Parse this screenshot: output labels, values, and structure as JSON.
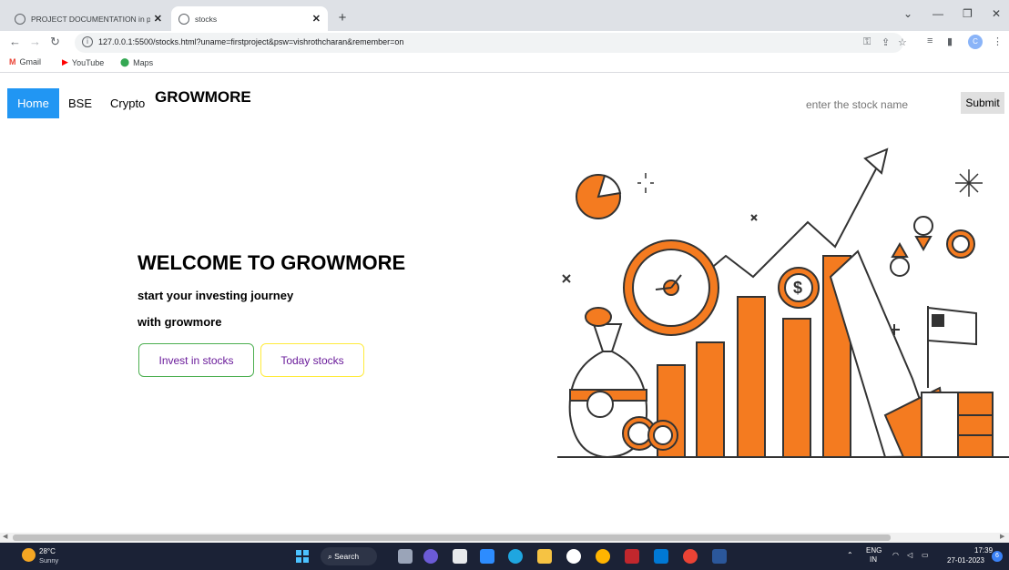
{
  "browser": {
    "tabs": [
      {
        "title": "PROJECT DOCUMENTATION in p",
        "active": false
      },
      {
        "title": "stocks",
        "active": true
      }
    ],
    "url": "127.0.0.1:5500/stocks.html?uname=firstproject&psw=vishrothcharan&remember=on",
    "bookmarks": [
      {
        "label": "Gmail",
        "icon": "gmail-icon",
        "color": "#ea4335"
      },
      {
        "label": "YouTube",
        "icon": "youtube-icon",
        "color": "#ff0000"
      },
      {
        "label": "Maps",
        "icon": "maps-icon",
        "color": "#34a853"
      }
    ],
    "profile_initial": "C"
  },
  "page": {
    "nav": {
      "home": "Home",
      "bse": "BSE",
      "crypto": "Crypto",
      "brand": "GROWMORE"
    },
    "search": {
      "placeholder": "enter the stock name",
      "submit": "Submit"
    },
    "hero": {
      "title": "WELCOME TO GROWMORE",
      "line1": "start your investing journey",
      "line2": "with growmore",
      "invest_button": "Invest in stocks",
      "today_button": "Today stocks"
    },
    "colors": {
      "accent": "#2196f3",
      "illustration_orange": "#f47b20",
      "invest_border": "#4caf50",
      "today_border": "#ffeb3b"
    }
  },
  "taskbar": {
    "weather_temp": "28°C",
    "weather_desc": "Sunny",
    "search_label": "Search",
    "lang_top": "ENG",
    "lang_bottom": "IN",
    "time": "17:39",
    "date": "27-01-2023",
    "notifications": "6"
  }
}
